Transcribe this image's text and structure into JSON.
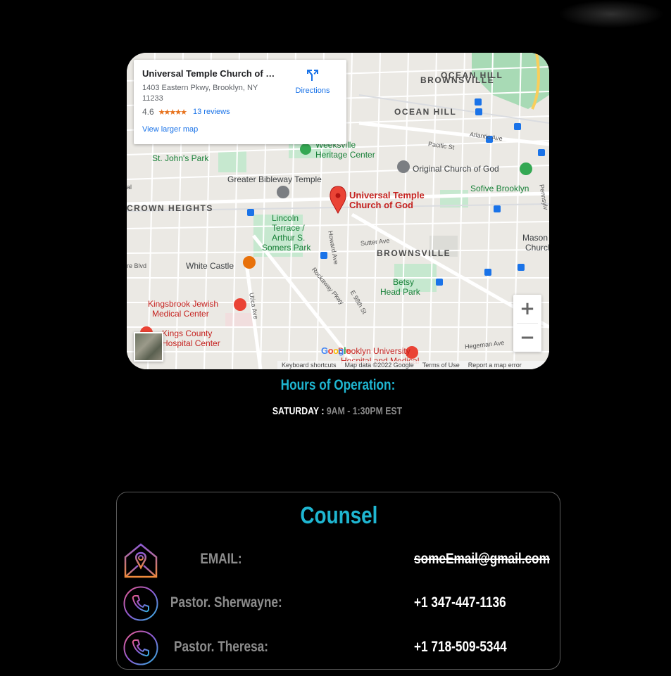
{
  "map": {
    "card": {
      "title": "Universal Temple Church of G...",
      "address": "1403 Eastern Pkwy, Brooklyn, NY 11233",
      "rating": "4.6",
      "stars": "★★★★★",
      "reviews": "13 reviews",
      "larger_map": "View larger map",
      "directions": "Directions"
    },
    "labels": {
      "ocean_hill_1": "OCEAN HILL",
      "ocean_hill_2": "BROWNSVILLE",
      "ocean_hill_3": "OCEAN HILL",
      "crown_heights": "CROWN HEIGHTS",
      "brownsville": "BROWNSVILLE",
      "weeksville_1": "Weeksville",
      "weeksville_2": "Heritage Center",
      "st_johns": "St. John's Park",
      "greater_bibleway": "Greater Bibleway Temple",
      "original_church": "Original Church of God",
      "sofive": "Sofive Brooklyn",
      "universal_1": "Universal Temple",
      "universal_2": "Church of God",
      "lincoln_1": "Lincoln",
      "lincoln_2": "Terrace /",
      "lincoln_3": "Arthur S.",
      "lincoln_4": "Somers Park",
      "white_castle": "White Castle",
      "betsy_1": "Betsy",
      "betsy_2": "Head Park",
      "mason_1": "Mason Te",
      "mason_2": "Church of",
      "kingsbrook_1": "Kingsbrook Jewish",
      "kingsbrook_2": "Medical Center",
      "kings_county_1": "Kings County",
      "kings_county_2": "Hospital Center",
      "brooklyn_univ_1": "Brooklyn University",
      "brooklyn_univ_2": "Hospital and Medical",
      "atlantic_ave": "Atlantic Ave",
      "pacific_st": "Pacific St",
      "sutter_ave": "Sutter Ave",
      "howard_ave": "Howard Ave",
      "rockaway_pkwy": "Rockaway Pkwy",
      "e98th": "E 98th St",
      "utica_ave": "Utica Ave",
      "hegeman_ave": "Hegeman Ave",
      "re_blvd": "re Blvd",
      "al": "al",
      "pennsylvania": "Pennsylv"
    },
    "zoom_in": "+",
    "zoom_out": "−",
    "attribution": {
      "shortcuts": "Keyboard shortcuts",
      "map_data": "Map data ©2022 Google",
      "terms": "Terms of Use",
      "report": "Report a map error"
    },
    "google": [
      "G",
      "o",
      "o",
      "g",
      "l",
      "e"
    ],
    "google_colors": [
      "#4285f4",
      "#ea4335",
      "#fbbc05",
      "#4285f4",
      "#34a853",
      "#ea4335"
    ]
  },
  "hours": {
    "title": "Hours of Operation:",
    "day": "SATURDAY : ",
    "time": "9AM - 1:30PM EST"
  },
  "counsel": {
    "title": "Counsel",
    "rows": [
      {
        "icon": "mail-location-icon",
        "label": "EMAIL:",
        "value": "someEmail@gmail.com"
      },
      {
        "icon": "phone-icon",
        "label": "Pastor. Sherwayne:",
        "value": "+1 347-447-1136"
      },
      {
        "icon": "phone-icon",
        "label": "Pastor. Theresa:",
        "value": "+1 718-509-5344"
      }
    ]
  },
  "colors": {
    "accent": "#1fb6d1",
    "label_gray": "#8c8c8c",
    "pin_red": "#ea4335"
  }
}
